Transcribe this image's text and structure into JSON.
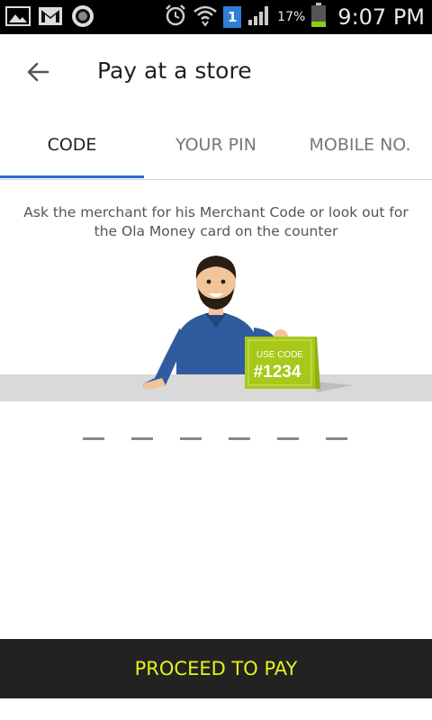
{
  "status_bar": {
    "battery_percent": "17%",
    "time": "9:07 PM",
    "notification_badge": "1",
    "icons": [
      "gallery-icon",
      "gmail-icon",
      "circle-app-icon",
      "alarm-icon",
      "wifi-icon",
      "sim-icon",
      "signal-icon",
      "battery-icon"
    ]
  },
  "header": {
    "title": "Pay at a store",
    "back_icon": "back-arrow-icon"
  },
  "tabs": [
    {
      "label": "CODE",
      "active": true
    },
    {
      "label": "YOUR PIN",
      "active": false
    },
    {
      "label": "MOBILE NO.",
      "active": false
    }
  ],
  "instruction": "Ask the merchant for his Merchant Code or look out for the Ola Money card on the counter",
  "illustration": {
    "card_line1": "USE CODE",
    "card_line2": "#1234"
  },
  "code_entry": {
    "slots": 6
  },
  "proceed_label": "PROCEED TO PAY",
  "colors": {
    "accent": "#2b6fd6",
    "proceed_bg": "#222222",
    "proceed_text": "#e3f21a",
    "card_green": "#a8c81a"
  }
}
